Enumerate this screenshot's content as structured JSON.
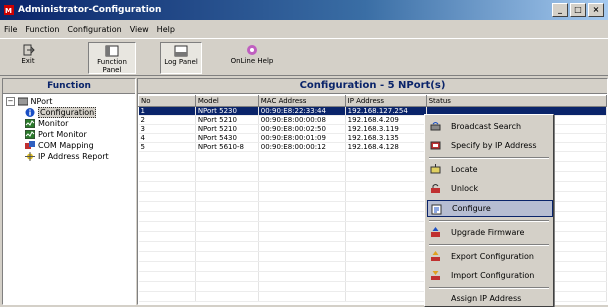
{
  "window": {
    "title": "Administrator-Configuration",
    "min": "_",
    "max": "□",
    "close": "×"
  },
  "menu": [
    "File",
    "Function",
    "Configuration",
    "View",
    "Help"
  ],
  "toolbar": {
    "exit": "Exit",
    "function_panel": "Function Panel",
    "log_panel": "Log Panel",
    "online_help": "OnLine Help"
  },
  "function_panel": {
    "title": "Function",
    "root": "NPort",
    "items": [
      "Configuration",
      "Monitor",
      "Port Monitor",
      "COM Mapping",
      "IP Address Report"
    ]
  },
  "config": {
    "title": "Configuration - 5 NPort(s)",
    "columns": [
      "No",
      "Model",
      "MAC Address",
      "IP Address",
      "Status"
    ],
    "rows": [
      [
        "1",
        "NPort 5230",
        "00:90:E8:22:33:44",
        "192.168.127.254",
        ""
      ],
      [
        "2",
        "NPort 5210",
        "00:90:E8:00:00:08",
        "192.168.4.209",
        ""
      ],
      [
        "3",
        "NPort 5210",
        "00:90:E8:00:02:50",
        "192.168.3.119",
        ""
      ],
      [
        "4",
        "NPort 5430",
        "00:90:E8:00:01:09",
        "192.168.3.135",
        ""
      ],
      [
        "5",
        "NPort 5610-8",
        "00:90:E8:00:00:12",
        "192.168.4.128",
        ""
      ]
    ]
  },
  "context_menu": [
    {
      "label": "Broadcast Search",
      "icon": "broadcast-icon"
    },
    {
      "label": "Specify by IP Address",
      "icon": "ip-icon"
    },
    {
      "label": "Locate",
      "icon": "locate-icon"
    },
    {
      "label": "Unlock",
      "icon": "unlock-icon"
    },
    {
      "label": "Configure",
      "icon": "configure-icon"
    },
    {
      "label": "Upgrade Firmware",
      "icon": "upgrade-icon"
    },
    {
      "label": "Export Configuration",
      "icon": "export-icon"
    },
    {
      "label": "Import Configuration",
      "icon": "import-icon"
    },
    {
      "label": "Assign IP Address",
      "icon": ""
    }
  ]
}
